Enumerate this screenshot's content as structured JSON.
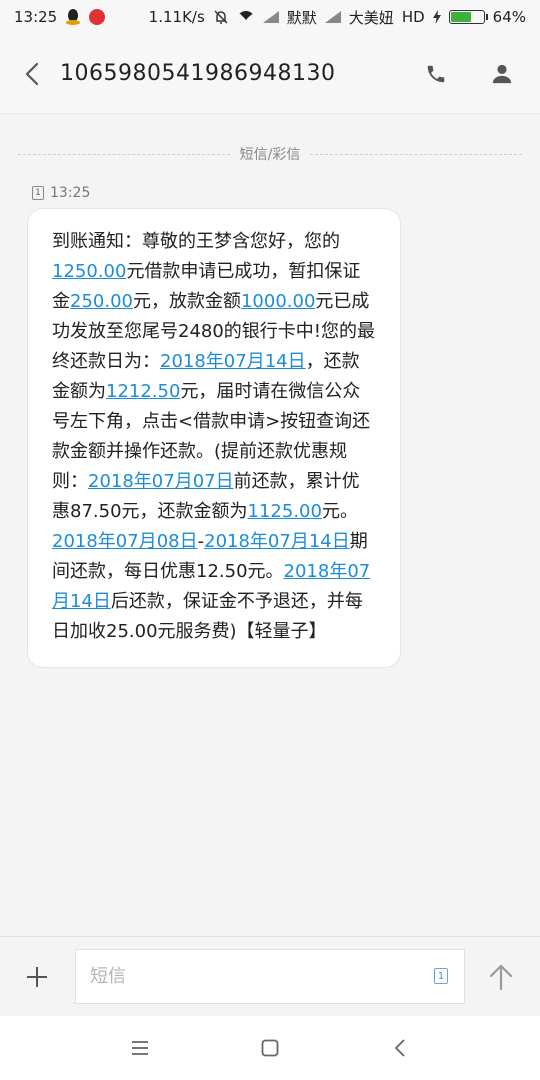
{
  "status_bar": {
    "time": "13:25",
    "net_speed": "1.11K/s",
    "carrier_1": "默默",
    "carrier_2": "大美妞",
    "hd_label": "HD",
    "battery_percent": "64%",
    "battery_level": 0.64
  },
  "header": {
    "contact_number": "1065980541986948130"
  },
  "conversation": {
    "divider_label": "短信/彩信",
    "sim_slot": "1",
    "timestamp": "13:25",
    "message": [
      {
        "t": "到账通知：尊敬的王梦含您好，您的"
      },
      {
        "t": "1250.00",
        "link": true
      },
      {
        "t": "元借款申请已成功，暂扣保证金"
      },
      {
        "t": "250.00",
        "link": true
      },
      {
        "t": "元，放款金额"
      },
      {
        "t": "1000.00",
        "link": true
      },
      {
        "t": "元已成功发放至您尾号2480的银行卡中!您的最终还款日为："
      },
      {
        "t": "2018年07月14日",
        "link": true
      },
      {
        "t": "，还款金额为"
      },
      {
        "t": "1212.50",
        "link": true
      },
      {
        "t": "元，届时请在微信公众号左下角，点击<借款申请>按钮查询还款金额并操作还款。(提前还款优惠规则："
      },
      {
        "t": "2018年07月07日",
        "link": true
      },
      {
        "t": "前还款，累计优惠87.50元，还款金额为"
      },
      {
        "t": "1125.00",
        "link": true
      },
      {
        "t": "元。"
      },
      {
        "t": "2018年07月08日",
        "link": true
      },
      {
        "t": "-"
      },
      {
        "t": "2018年07月14日",
        "link": true
      },
      {
        "t": "期间还款，每日优惠12.50元。"
      },
      {
        "t": "2018年07月14日",
        "link": true
      },
      {
        "t": "后还款，保证金不予退还，并每日加收25.00元服务费)【轻量子】"
      }
    ]
  },
  "input_bar": {
    "placeholder": "短信",
    "value": "",
    "sim_slot": "1"
  },
  "colors": {
    "link": "#1e8dd8",
    "battery": "#3bb33b"
  }
}
